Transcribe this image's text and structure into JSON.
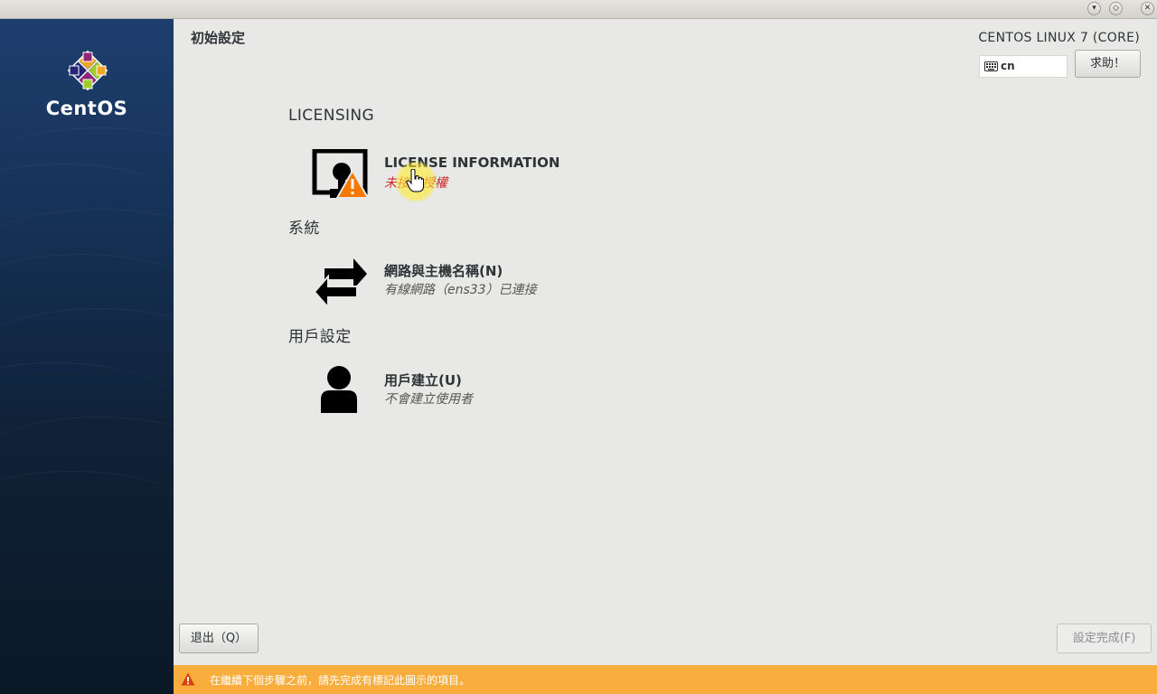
{
  "window": {
    "controls": [
      {
        "name": "minimize",
        "icon": "chevron-down-icon"
      },
      {
        "name": "maximize",
        "icon": "maximize-icon"
      },
      {
        "name": "close",
        "icon": "close-icon"
      }
    ]
  },
  "sidebar": {
    "logo_text": "CentOS"
  },
  "header": {
    "title": "初始設定",
    "product": "CENTOS LINUX 7 (CORE)",
    "keyboard_layout": "cn",
    "help_label": "求助！"
  },
  "sections": [
    {
      "heading": "LICENSING",
      "spokes": [
        {
          "title": "LICENSE INFORMATION",
          "status": "未接受授權",
          "icon": "license-warning-icon",
          "status_color": "#cc2a2a"
        }
      ]
    },
    {
      "heading": "系統",
      "spokes": [
        {
          "title": "網路與主機名稱(N)",
          "status": "有線網路（ens33）已連接",
          "icon": "network-arrows-icon"
        }
      ]
    },
    {
      "heading": "用戶設定",
      "spokes": [
        {
          "title": "用戶建立(U)",
          "status": "不會建立使用者",
          "icon": "user-icon"
        }
      ]
    }
  ],
  "footer": {
    "quit_label": "退出（Q）",
    "finish_label": "設定完成(F)",
    "warning_text": "在繼續下個步驟之前，請先完成有標記此圖示的項目。"
  },
  "colors": {
    "sidebar": "#163156",
    "warning_bar": "#f9ad3d",
    "warning_text": "#cc2a2a",
    "background": "#e8e8e7"
  }
}
